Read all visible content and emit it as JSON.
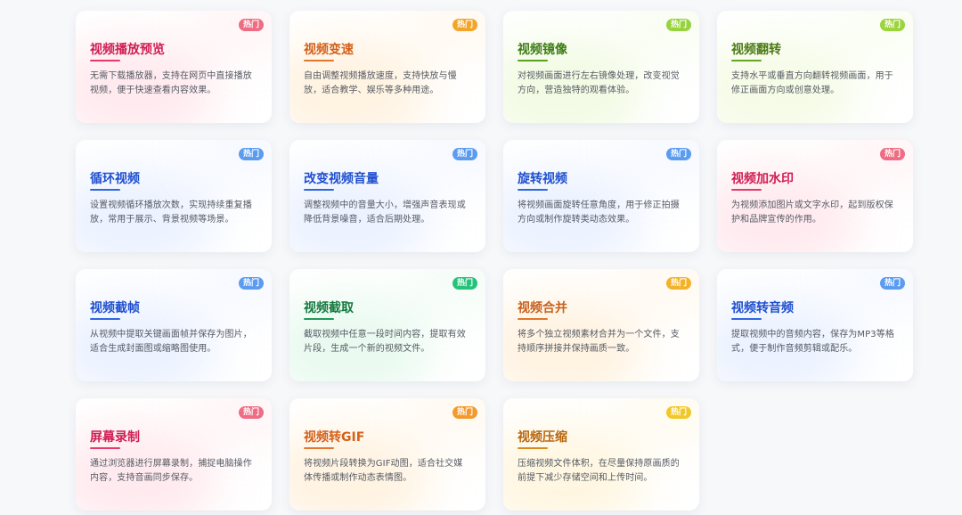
{
  "colors": {
    "red": "#d81e5b",
    "orange": "#e0691b",
    "green": "#2f8a1a",
    "blue": "#2557d6",
    "teal": "#148a45",
    "badge_red": "#ee6d83",
    "badge_orange": "#f39a2e",
    "badge_yellow": "#f0b81e",
    "badge_green": "#8ed23a",
    "badge_blue": "#5b9bf0",
    "badge_teal": "#27c27a"
  },
  "cards": [
    {
      "title": "视频播放预览",
      "desc": "无需下载播放器，支持在网页中直接播放视频，便于快速查看内容效果。",
      "badge": "热门",
      "title_color": "#cf1d52",
      "line_color": "#e23a6a",
      "glow_color": "#ffc2cf",
      "badge_color": "#ee6d83"
    },
    {
      "title": "视频变速",
      "desc": "自由调整视频播放速度，支持快放与慢放，适合教学、娱乐等多种用途。",
      "badge": "热门",
      "title_color": "#d4601a",
      "line_color": "#e2762c",
      "glow_color": "#ffdcaa",
      "badge_color": "#f3a52a"
    },
    {
      "title": "视频镜像",
      "desc": "对视频画面进行左右镜像处理，改变视觉方向，营造独特的观看体验。",
      "badge": "热门",
      "title_color": "#3d7d14",
      "line_color": "#5aa11d",
      "glow_color": "#d9f3b0",
      "badge_color": "#97d33e"
    },
    {
      "title": "视频翻转",
      "desc": "支持水平或垂直方向翻转视频画面，用于修正画面方向或创意处理。",
      "badge": "热门",
      "title_color": "#4c7a14",
      "line_color": "#6aa424",
      "glow_color": "#e3f5b8",
      "badge_color": "#9bd43c"
    },
    {
      "title": "循环视频",
      "desc": "设置视频循环播放次数，实现持续重复播放，常用于展示、背景视频等场景。",
      "badge": "热门",
      "title_color": "#1f4fcf",
      "line_color": "#2f66e0",
      "glow_color": "#c7d9ff",
      "badge_color": "#5b9bf0"
    },
    {
      "title": "改变视频音量",
      "desc": "调整视频中的音量大小，增强声音表现或降低背景噪音，适合后期处理。",
      "badge": "热门",
      "title_color": "#1f4fcf",
      "line_color": "#2f66e0",
      "glow_color": "#c7d9ff",
      "badge_color": "#5b9bf0"
    },
    {
      "title": "旋转视频",
      "desc": "将视频画面旋转任意角度，用于修正拍摄方向或制作旋转类动态效果。",
      "badge": "热门",
      "title_color": "#1f4fcf",
      "line_color": "#2f66e0",
      "glow_color": "#c7d9ff",
      "badge_color": "#5b9bf0"
    },
    {
      "title": "视频加水印",
      "desc": "为视频添加图片或文字水印，起到版权保护和品牌宣传的作用。",
      "badge": "热门",
      "title_color": "#cf1d52",
      "line_color": "#e23a6a",
      "glow_color": "#ffc2cf",
      "badge_color": "#ee6d83"
    },
    {
      "title": "视频截帧",
      "desc": "从视频中提取关键画面帧并保存为图片，适合生成封面图或缩略图使用。",
      "badge": "热门",
      "title_color": "#1f4fcf",
      "line_color": "#2f66e0",
      "glow_color": "#c7d9ff",
      "badge_color": "#5b9bf0"
    },
    {
      "title": "视频截取",
      "desc": "截取视频中任意一段时间内容，提取有效片段，生成一个新的视频文件。",
      "badge": "热门",
      "title_color": "#137a3e",
      "line_color": "#1f9a55",
      "glow_color": "#bff0d3",
      "badge_color": "#27c27a"
    },
    {
      "title": "视频合并",
      "desc": "将多个独立视频素材合并为一个文件，支持顺序拼接并保持画质一致。",
      "badge": "热门",
      "title_color": "#c9601b",
      "line_color": "#e2762c",
      "glow_color": "#ffdcaa",
      "badge_color": "#f3b22a"
    },
    {
      "title": "视频转音频",
      "desc": "提取视频中的音频内容，保存为MP3等格式，便于制作音频剪辑或配乐。",
      "badge": "热门",
      "title_color": "#1f4fcf",
      "line_color": "#2f66e0",
      "glow_color": "#c7d9ff",
      "badge_color": "#5b9bf0"
    },
    {
      "title": "屏幕录制",
      "desc": "通过浏览器进行屏幕录制，捕捉电脑操作内容，支持音画同步保存。",
      "badge": "热门",
      "title_color": "#cf1d52",
      "line_color": "#e23a6a",
      "glow_color": "#ffc2cf",
      "badge_color": "#ee6d83"
    },
    {
      "title": "视频转GIF",
      "desc": "将视频片段转换为GIF动图，适合社交媒体传播或制作动态表情图。",
      "badge": "热门",
      "title_color": "#d4601a",
      "line_color": "#e2762c",
      "glow_color": "#ffdcaa",
      "badge_color": "#f39a2e"
    },
    {
      "title": "视频压缩",
      "desc": "压缩视频文件体积，在尽量保持原画质的前提下减少存储空间和上传时间。",
      "badge": "热门",
      "title_color": "#b8660f",
      "line_color": "#d98a1c",
      "glow_color": "#ffe6a8",
      "badge_color": "#f0c82a"
    }
  ]
}
